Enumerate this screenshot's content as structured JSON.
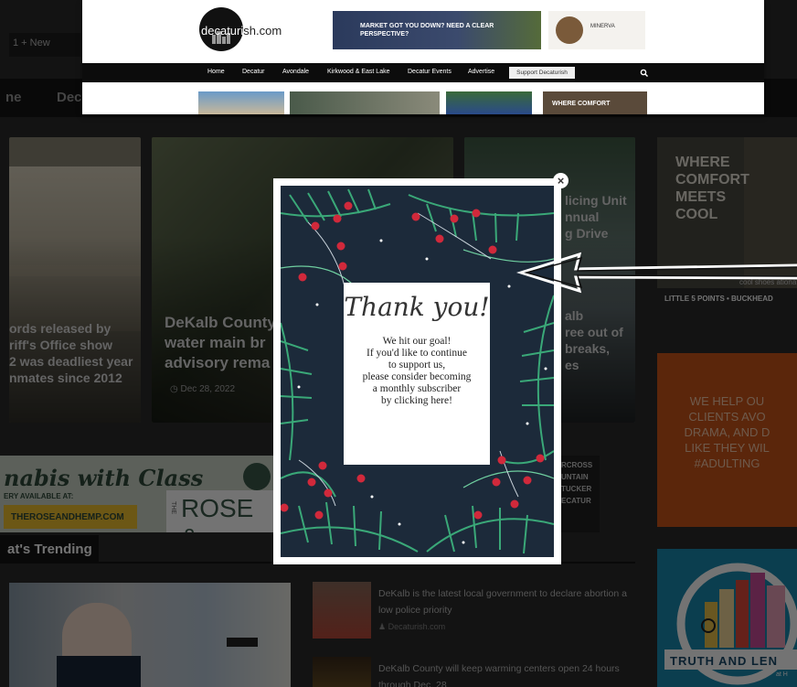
{
  "adminbar": {
    "label": "1  +  New"
  },
  "site_nav": {
    "items": [
      "ne",
      "Dec"
    ]
  },
  "header": {
    "logo_text": "decaturish.com",
    "ad1_text": "MARKET GOT YOU DOWN? NEED A CLEAR PERSPECTIVE?",
    "ad2_text": "MINERVA",
    "nav": [
      "Home",
      "Decatur",
      "Avondale",
      "Kirkwood & East Lake",
      "Decatur Events",
      "Advertise"
    ],
    "support_label": "Support Decaturish",
    "thumb_text": "WHERE COMFORT"
  },
  "cards": [
    {
      "title": "ords released by\nriff's Office show\n2 was deadliest year\nnmates since 2012",
      "date": ""
    },
    {
      "title": "DeKalb County\nwater main br\nadvisory rema",
      "date": "Dec 28, 2022"
    },
    {
      "title": "licing Unit\nnnual\ng Drive",
      "date": ""
    },
    {
      "title": "alb\nree out of\nbreaks,\nes",
      "date": ""
    }
  ],
  "modal": {
    "close_label": "×",
    "script_title": "Thank you!",
    "message": "We hit our goal!\nIf you'd like to continue\nto support us,\nplease consider becoming\na monthly subscriber\nby clicking here!"
  },
  "side_ads": {
    "ad1_words": "WHERE\nCOMFORT\nMEETS\nCOOL",
    "ad1_small": "cool shoes ationa",
    "ad1_caption": "LITTLE 5 POINTS • BUCKHEAD",
    "ad2_text": "WE HELP OU\nCLIENTS AVO\nDRAMA, AND D\nLIKE THEY WIL\n#ADULTING",
    "ad2_bold": "WIL",
    "ad3_text": "TRUTH AND LEN",
    "ad3_small": "at H"
  },
  "banner": {
    "title": "nabis with Class",
    "sub": "ERY AVAILABLE AT:",
    "url": "THEROSEANDHEMP.COM",
    "brand": "ROSE &",
    "brand_small": "THE",
    "side_ad": "RCROSS\nUNTAIN\nTUCKER\nECATUR"
  },
  "trending": {
    "label": "at's Trending"
  },
  "news": [
    {
      "title": "DeKalb is the latest local government to declare abortion a low police priority",
      "source": "Decaturish.com"
    },
    {
      "title": "DeKalb County will keep warming centers open 24 hours through Dec. 28",
      "source": ""
    }
  ]
}
